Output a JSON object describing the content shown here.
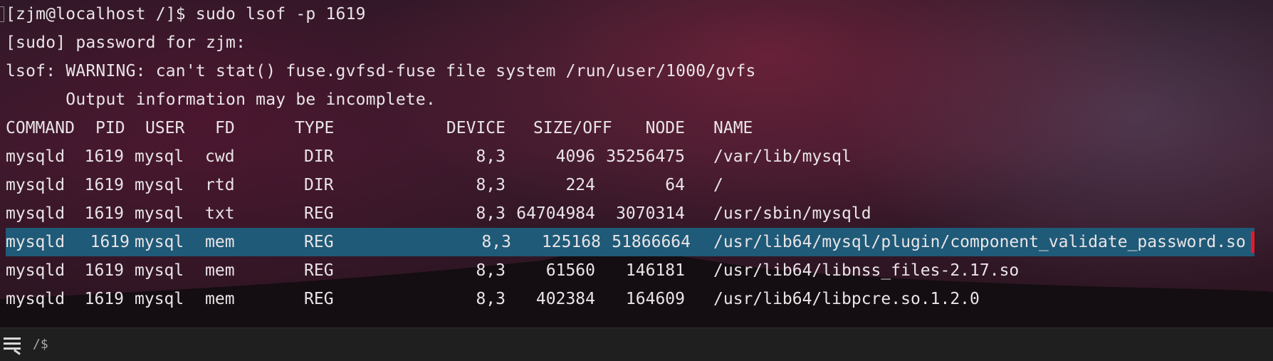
{
  "terminal": {
    "prompt_line": "[zjm@localhost /]$ sudo lsof -p 1619",
    "sudo_prompt": "[sudo] password for zjm:",
    "warning_line": "lsof: WARNING: can't stat() fuse.gvfsd-fuse file system /run/user/1000/gvfs",
    "warning_detail": "      Output information may be incomplete.",
    "headers": {
      "command": "COMMAND",
      "pid": "PID",
      "user": "USER",
      "fd": "FD",
      "type": "TYPE",
      "device": "DEVICE",
      "size_off": "SIZE/OFF",
      "node": "NODE",
      "name": "NAME"
    },
    "rows": [
      {
        "command": "mysqld",
        "pid": "1619",
        "user": "mysql",
        "fd": "cwd",
        "type": "DIR",
        "device": "8,3",
        "size_off": "4096",
        "node": "35256475",
        "name": "/var/lib/mysql"
      },
      {
        "command": "mysqld",
        "pid": "1619",
        "user": "mysql",
        "fd": "rtd",
        "type": "DIR",
        "device": "8,3",
        "size_off": "224",
        "node": "64",
        "name": "/"
      },
      {
        "command": "mysqld",
        "pid": "1619",
        "user": "mysql",
        "fd": "txt",
        "type": "REG",
        "device": "8,3",
        "size_off": "64704984",
        "node": "3070314",
        "name": "/usr/sbin/mysqld"
      },
      {
        "command": "mysqld",
        "pid": "1619",
        "user": "mysql",
        "fd": "mem",
        "type": "REG",
        "device": "8,3",
        "size_off": "125168",
        "node": "51866664",
        "name": "/usr/lib64/mysql/plugin/component_validate_password.so",
        "highlighted": true
      },
      {
        "command": "mysqld",
        "pid": "1619",
        "user": "mysql",
        "fd": "mem",
        "type": "REG",
        "device": "8,3",
        "size_off": "61560",
        "node": "146181",
        "name": "/usr/lib64/libnss_files-2.17.so"
      },
      {
        "command": "mysqld",
        "pid": "1619",
        "user": "mysql",
        "fd": "mem",
        "type": "REG",
        "device": "8,3",
        "size_off": "402384",
        "node": "164609",
        "name": "/usr/lib64/libpcre.so.1.2.0"
      }
    ]
  },
  "status_bar": {
    "menu_icon": "hamburger-menu-icon",
    "path": "/$"
  },
  "colors": {
    "highlight": "#1f5a78",
    "cursor": "#e11b2a",
    "status_bar": "#1f1f1f"
  }
}
